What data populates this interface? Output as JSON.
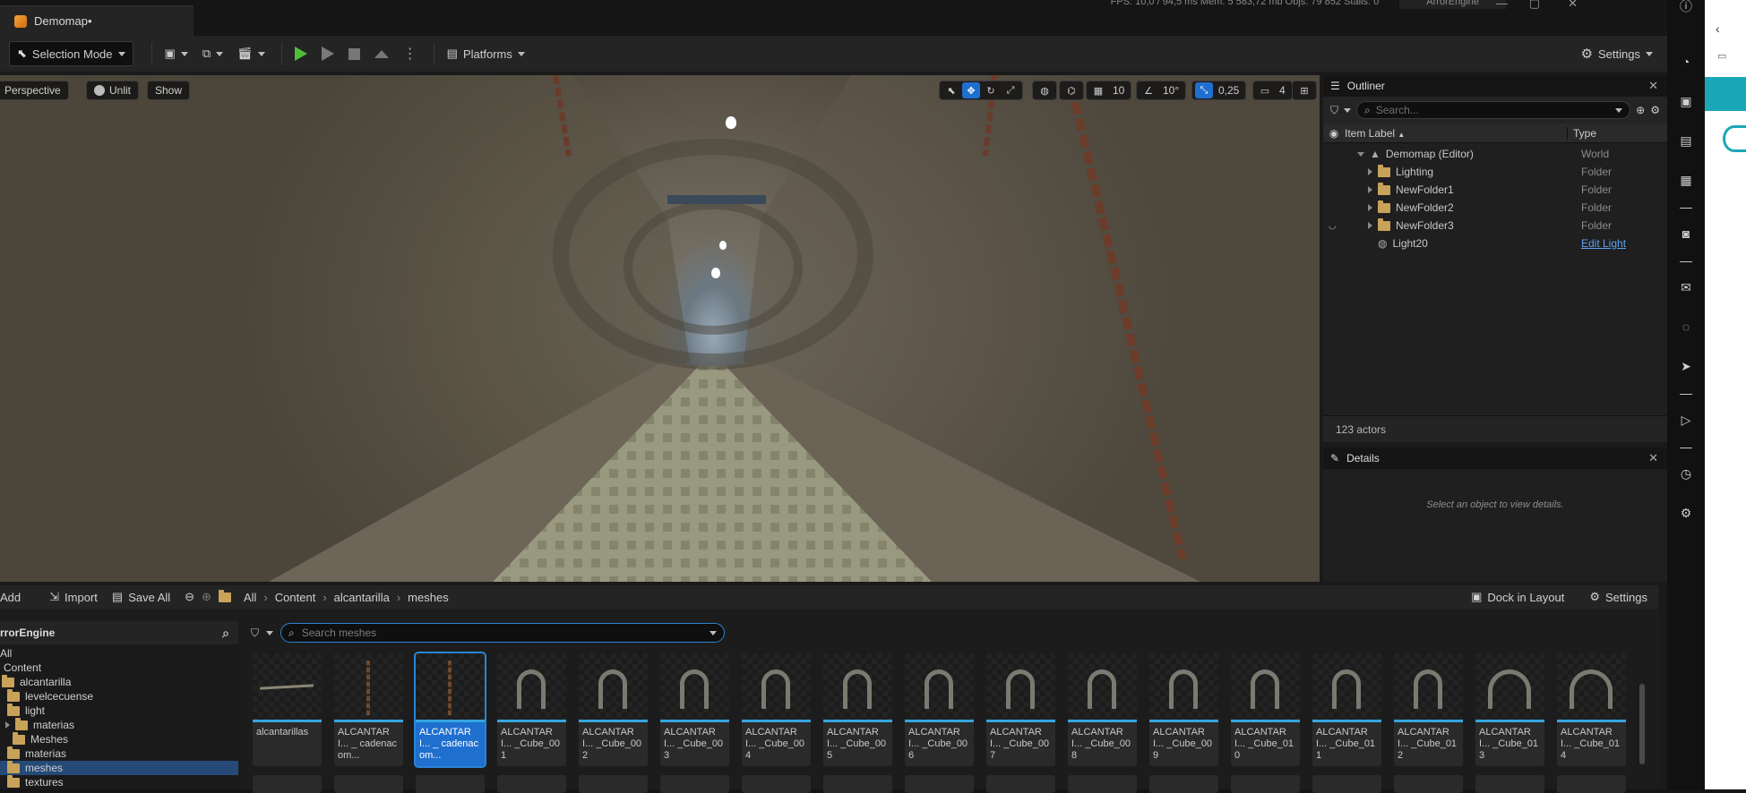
{
  "title_bar": {
    "document_tab": "Demomap•",
    "status": "FPS: 10,0 / 94,5 ms   Mem: 5 583,72 mb   Objs: 79 852   Stalls: 0",
    "project": "ArrorEngine"
  },
  "toolbar": {
    "mode": "Selection Mode",
    "platforms": "Platforms",
    "settings": "Settings"
  },
  "viewport": {
    "perspective": "Perspective",
    "unlit": "Unlit",
    "show": "Show",
    "grid_snap": "10",
    "rotation_snap": "10°",
    "scale_snap": "0,25",
    "camera_speed": "4"
  },
  "outliner": {
    "tab": "Outliner",
    "search_placeholder": "Search...",
    "col_label": "Item Label",
    "col_type": "Type",
    "root": {
      "label": "Demomap (Editor)",
      "type": "World"
    },
    "items": [
      {
        "label": "Lighting",
        "type": "Folder"
      },
      {
        "label": "NewFolder1",
        "type": "Folder"
      },
      {
        "label": "NewFolder2",
        "type": "Folder"
      },
      {
        "label": "NewFolder3",
        "type": "Folder"
      },
      {
        "label": "Light20",
        "type": "Edit Light"
      }
    ],
    "actor_count": "123 actors"
  },
  "details": {
    "tab": "Details",
    "empty": "Select an object to view details."
  },
  "content_browser": {
    "add": "Add",
    "import": "Import",
    "save_all": "Save All",
    "breadcrumb": [
      "All",
      "Content",
      "alcantarilla",
      "meshes"
    ],
    "dock": "Dock in Layout",
    "settings": "Settings",
    "tree_root": "rrorEngine",
    "tree": [
      {
        "label": "All"
      },
      {
        "label": "Content"
      },
      {
        "label": "alcantarilla"
      },
      {
        "label": "levelcecuense"
      },
      {
        "label": "light"
      },
      {
        "label": "materias"
      },
      {
        "label": "Meshes"
      },
      {
        "label": "materias"
      },
      {
        "label": "meshes"
      },
      {
        "label": "textures"
      }
    ],
    "search_placeholder": "Search meshes",
    "assets": [
      {
        "label": "alcantarillas"
      },
      {
        "label": "ALCANTARI... _ cadenacom..."
      },
      {
        "label": "ALCANTARI... _ cadenacom..."
      },
      {
        "label": "ALCANTARI... _Cube_001"
      },
      {
        "label": "ALCANTARI... _Cube_002"
      },
      {
        "label": "ALCANTARI... _Cube_003"
      },
      {
        "label": "ALCANTARI... _Cube_004"
      },
      {
        "label": "ALCANTARI... _Cube_005"
      },
      {
        "label": "ALCANTARI... _Cube_006"
      },
      {
        "label": "ALCANTARI... _Cube_007"
      },
      {
        "label": "ALCANTARI... _Cube_008"
      },
      {
        "label": "ALCANTARI... _Cube_009"
      },
      {
        "label": "ALCANTARI... _Cube_010"
      },
      {
        "label": "ALCANTARI... _Cube_011"
      },
      {
        "label": "ALCANTARI... _Cube_012"
      },
      {
        "label": "ALCANTARI... _Cube_013"
      },
      {
        "label": "ALCANTARI... _Cube_014"
      }
    ]
  },
  "colors": {
    "accent": "#1f6fcf",
    "play": "#4fbf3b",
    "folder": "#c9a25a",
    "link": "#5ea2ef"
  }
}
